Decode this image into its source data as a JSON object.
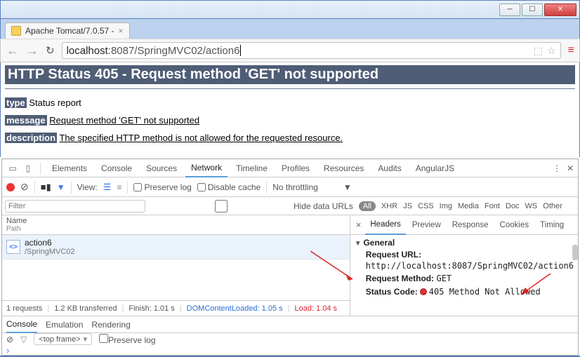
{
  "window": {
    "tab_title": "Apache Tomcat/7.0.57 -"
  },
  "urlbar": {
    "host": "localhost",
    "port": ":8087",
    "path": "/SpringMVC02/action6"
  },
  "page": {
    "h1": "HTTP Status 405 - Request method 'GET' not supported",
    "type_label": "type",
    "type_value": "Status report",
    "message_label": "message",
    "message_value": "Request method 'GET' not supported",
    "description_label": "description",
    "description_value": "The specified HTTP method is not allowed for the requested resource."
  },
  "devtools": {
    "tabs": [
      "Elements",
      "Console",
      "Sources",
      "Network",
      "Timeline",
      "Profiles",
      "Resources",
      "Audits",
      "AngularJS"
    ],
    "active_tab": "Network",
    "toolbar": {
      "view_label": "View:",
      "preserve_log": "Preserve log",
      "disable_cache": "Disable cache",
      "throttling": "No throttling"
    },
    "filter": {
      "placeholder": "Filter",
      "hide_data_urls": "Hide data URLs",
      "all": "All",
      "types": [
        "XHR",
        "JS",
        "CSS",
        "Img",
        "Media",
        "Font",
        "Doc",
        "WS",
        "Other"
      ]
    },
    "netlist": {
      "col_name": "Name",
      "col_path": "Path",
      "rows": [
        {
          "name": "action6",
          "path": "/SpringMVC02"
        }
      ],
      "footer": {
        "requests": "1 requests",
        "transferred": "1.2 KB transferred",
        "finish": "Finish: 1.01 s",
        "dcl": "DOMContentLoaded: 1.05 s",
        "load": "Load: 1.04 s"
      }
    },
    "detail": {
      "tabs": [
        "Headers",
        "Preview",
        "Response",
        "Cookies",
        "Timing"
      ],
      "active": "Headers",
      "general_label": "General",
      "request_url_k": "Request URL:",
      "request_url_v": "http://localhost:8087/SpringMVC02/action6",
      "request_method_k": "Request Method:",
      "request_method_v": "GET",
      "status_code_k": "Status Code:",
      "status_code_v": "405 Method Not Allowed"
    },
    "drawer": {
      "tabs": [
        "Console",
        "Emulation",
        "Rendering"
      ],
      "active": "Console",
      "frame": "<top frame>",
      "preserve_log": "Preserve log"
    }
  }
}
